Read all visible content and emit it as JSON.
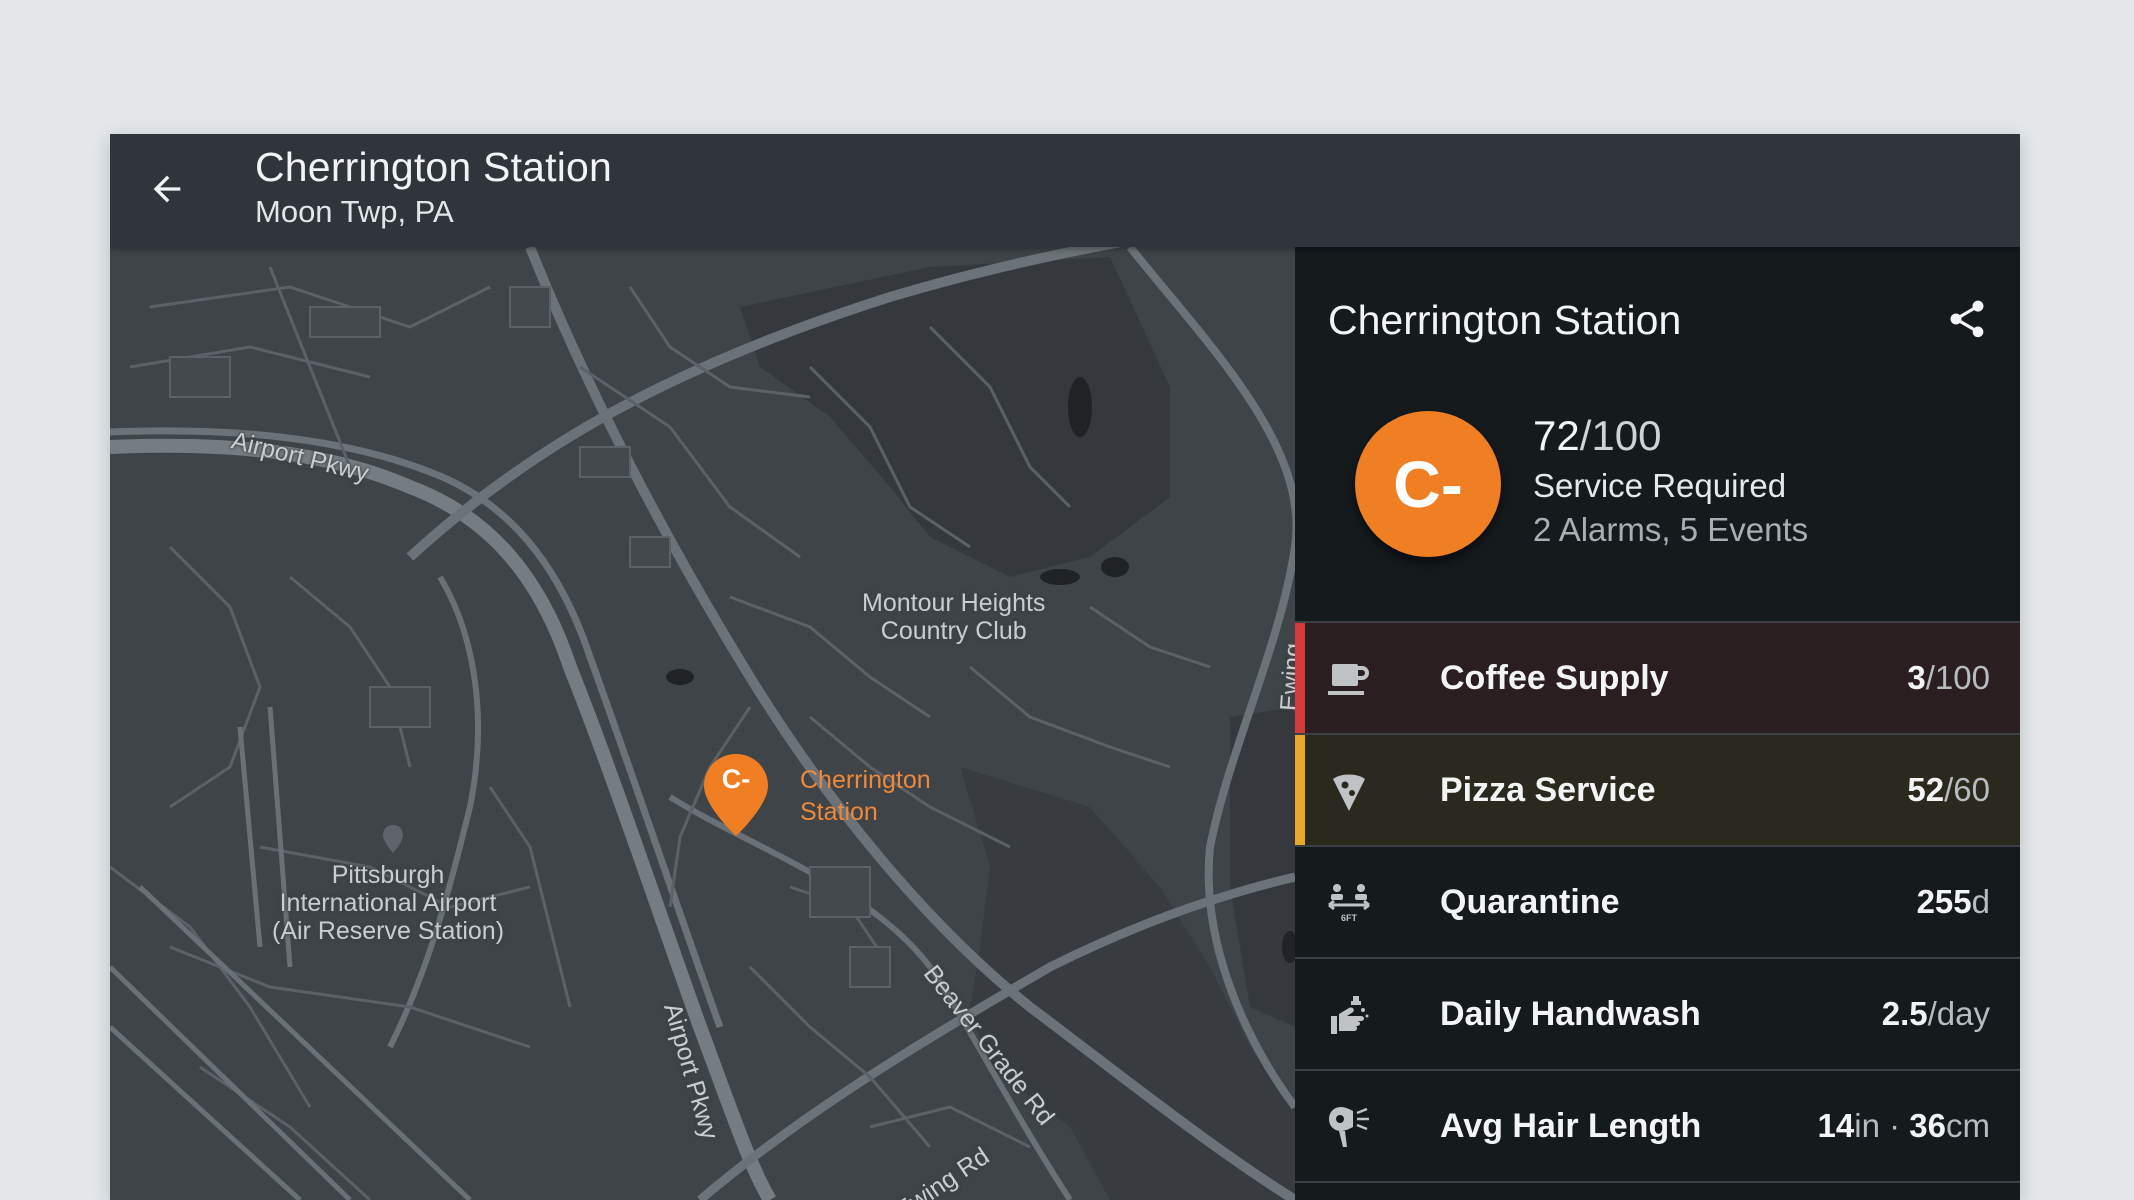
{
  "header": {
    "title": "Cherrington Station",
    "subtitle": "Moon Twp, PA"
  },
  "map": {
    "labels": {
      "airport_pkwy_top": "Airport Pkwy",
      "airport_pkwy_side": "Airport Pkwy",
      "montour_line1": "Montour Heights",
      "montour_line2": "Country Club",
      "pittsburgh_line1": "Pittsburgh",
      "pittsburgh_line2": "International Airport",
      "pittsburgh_line3": "(Air Reserve Station)",
      "beaver_grade": "Beaver Grade Rd",
      "ewing_rd": "Ewing Rd",
      "ewing_rd_edge": "Ewing Rd"
    },
    "pin": {
      "grade": "C-",
      "label_line1": "Cherrington",
      "label_line2": "Station"
    }
  },
  "panel": {
    "title": "Cherrington Station",
    "grade": "C-",
    "score": "72",
    "score_total": "/100",
    "status": "Service Required",
    "alarms": "2 Alarms, 5 Events",
    "metrics": [
      {
        "label": "Coffee Supply",
        "value": "3",
        "unit": "/100",
        "icon": "coffee-cup-icon",
        "status_color": "#d13b3b",
        "bg": "#2a1e20"
      },
      {
        "label": "Pizza Service",
        "value": "52",
        "unit": "/60",
        "icon": "pizza-icon",
        "status_color": "#e8a92a",
        "bg": "#2b281e"
      },
      {
        "label": "Quarantine",
        "value": "255",
        "unit": "d",
        "icon": "social-distance-icon",
        "status_color": "",
        "bg": "#151a1d"
      },
      {
        "label": "Daily Handwash",
        "value": "2.5",
        "unit": "/day",
        "icon": "handwash-icon",
        "status_color": "",
        "bg": "#151a1d"
      },
      {
        "label": "Avg Hair Length",
        "value": "14",
        "unit": "in · ",
        "value2": "36",
        "unit2": "cm",
        "icon": "hair-dryer-icon",
        "status_color": "",
        "bg": "#151a1d"
      }
    ]
  },
  "colors": {
    "accent_orange": "#f07f24",
    "alert_red": "#d13b3b",
    "warn_amber": "#e8a92a"
  }
}
